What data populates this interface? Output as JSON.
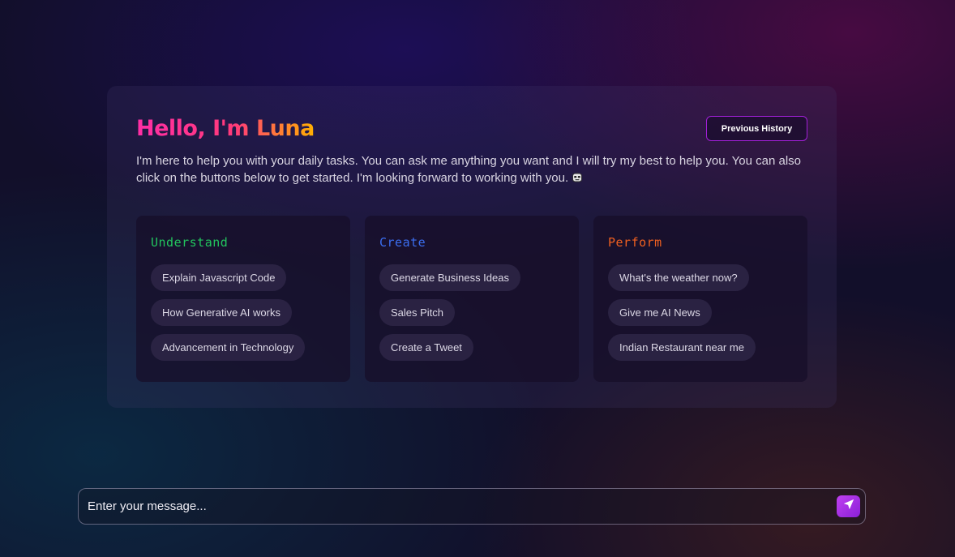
{
  "header": {
    "title": "Hello, I'm Luna",
    "history_button": "Previous History"
  },
  "intro": {
    "text": "I'm here to help you with your daily tasks. You can ask me anything you want and I will try my best to help you. You can also click on the buttons below to get started. I'm looking forward to working with you. ",
    "emoji_icon": "robot-face-icon"
  },
  "cards": [
    {
      "title": "Understand",
      "color": "#22c55e",
      "prompts": [
        "Explain Javascript Code",
        "How Generative AI works",
        "Advancement in Technology"
      ]
    },
    {
      "title": "Create",
      "color": "#3b6ef0",
      "prompts": [
        "Generate Business Ideas",
        "Sales Pitch",
        "Create a Tweet"
      ]
    },
    {
      "title": "Perform",
      "color": "#f06020",
      "prompts": [
        "What's the weather now?",
        "Give me AI News",
        "Indian Restaurant near me"
      ]
    }
  ],
  "composer": {
    "placeholder": "Enter your message...",
    "send_icon": "send-icon"
  }
}
